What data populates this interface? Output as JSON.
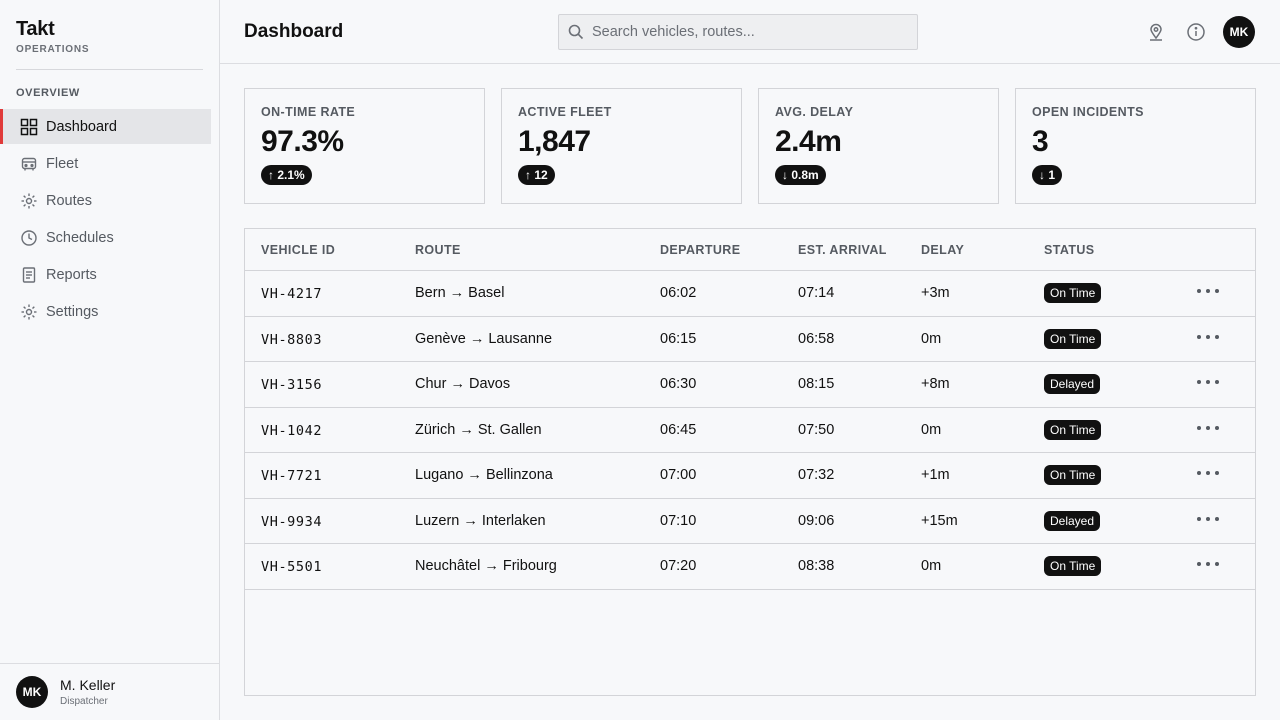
{
  "brand": {
    "name": "Takt",
    "subtitle": "OPERATIONS"
  },
  "nav": {
    "section_label": "OVERVIEW",
    "items": [
      {
        "label": "Dashboard",
        "icon": "grid-icon",
        "active": true
      },
      {
        "label": "Fleet",
        "icon": "bus-icon",
        "active": false
      },
      {
        "label": "Routes",
        "icon": "routes-icon",
        "active": false
      },
      {
        "label": "Schedules",
        "icon": "clock-icon",
        "active": false
      },
      {
        "label": "Reports",
        "icon": "document-icon",
        "active": false
      },
      {
        "label": "Settings",
        "icon": "gear-icon",
        "active": false
      }
    ]
  },
  "user": {
    "initials": "MK",
    "name": "M. Keller",
    "role": "Dispatcher"
  },
  "header": {
    "title": "Dashboard",
    "search_placeholder": "Search vehicles, routes...",
    "avatar_initials": "MK"
  },
  "kpis": [
    {
      "label": "ON-TIME RATE",
      "value": "97.3%",
      "badge": "↑ 2.1%"
    },
    {
      "label": "ACTIVE FLEET",
      "value": "1,847",
      "badge": "↑ 12"
    },
    {
      "label": "AVG. DELAY",
      "value": "2.4m",
      "badge": "↓ 0.8m"
    },
    {
      "label": "OPEN INCIDENTS",
      "value": "3",
      "badge": "↓ 1"
    }
  ],
  "table": {
    "columns": [
      "VEHICLE ID",
      "ROUTE",
      "DEPARTURE",
      "EST. ARRIVAL",
      "DELAY",
      "STATUS"
    ],
    "rows": [
      {
        "id": "VH-4217",
        "route": "Bern → Basel",
        "departure": "06:02",
        "arrival": "07:14",
        "delay": "+3m",
        "status": "On Time"
      },
      {
        "id": "VH-8803",
        "route": "Genève → Lausanne",
        "departure": "06:15",
        "arrival": "06:58",
        "delay": "0m",
        "status": "On Time"
      },
      {
        "id": "VH-3156",
        "route": "Chur → Davos",
        "departure": "06:30",
        "arrival": "08:15",
        "delay": "+8m",
        "status": "Delayed"
      },
      {
        "id": "VH-1042",
        "route": "Zürich → St. Gallen",
        "departure": "06:45",
        "arrival": "07:50",
        "delay": "0m",
        "status": "On Time"
      },
      {
        "id": "VH-7721",
        "route": "Lugano → Bellinzona",
        "departure": "07:00",
        "arrival": "07:32",
        "delay": "+1m",
        "status": "On Time"
      },
      {
        "id": "VH-9934",
        "route": "Luzern → Interlaken",
        "departure": "07:10",
        "arrival": "09:06",
        "delay": "+15m",
        "status": "Delayed"
      },
      {
        "id": "VH-5501",
        "route": "Neuchâtel → Fribourg",
        "departure": "07:20",
        "arrival": "08:38",
        "delay": "0m",
        "status": "On Time"
      }
    ]
  },
  "colors": {
    "accent": "#e03a3a",
    "badge": "#111111"
  }
}
